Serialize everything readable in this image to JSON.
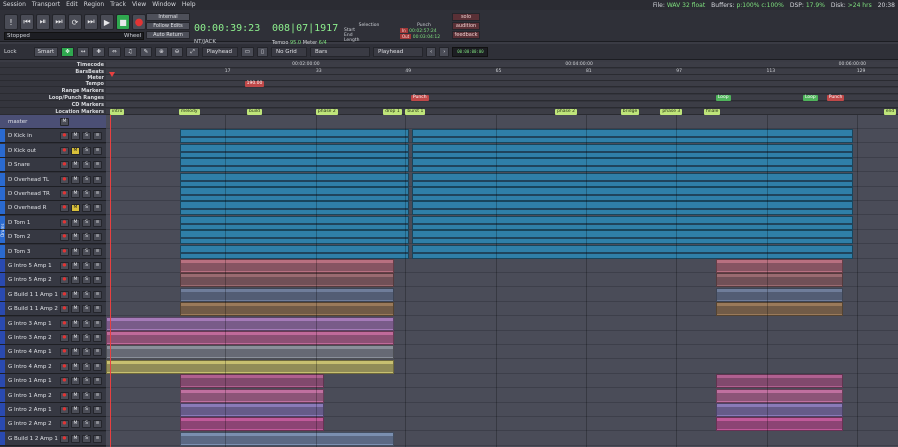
{
  "menu": [
    "Session",
    "Transport",
    "Edit",
    "Region",
    "Track",
    "View",
    "Window",
    "Help"
  ],
  "status": {
    "file_label": "File:",
    "file_val": "WAV 32 float",
    "buffers_label": "Buffers:",
    "buffers_val": "p:100% c:100%",
    "dsp_label": "DSP:",
    "dsp_val": "17.9%",
    "disk_label": "Disk:",
    "disk_val": ">24 hrs",
    "time": "20:38"
  },
  "transport": {
    "stopped_label": "Stopped",
    "wheel_label": "Wheel",
    "internal_label": "Internal",
    "follow_edits_label": "Follow Edits",
    "auto_return_label": "Auto Return",
    "clock_primary": "00:00:39:23",
    "clock_secondary": "008|07|1917",
    "jack_label": "NT/JACK",
    "tempo_label": "Tempo",
    "tempo_val": "95.0",
    "meter_label": "Meter",
    "meter_val": "6/4",
    "selection_label": "Selection",
    "start_label": "Start",
    "end_label": "End",
    "length_label": "Length",
    "punch_label": "Punch",
    "in_label": "In",
    "out_label": "Out",
    "punch_in_time": "00:02:57:24",
    "punch_out_time": "00:03:04:12",
    "solo_label": "solo",
    "audition_label": "audition",
    "feedback_label": "feedback"
  },
  "editbar": {
    "lock_label": "Lock",
    "smart_label": "Smart",
    "playhead_label": "Playhead",
    "grid_label": "No Grid",
    "bars_label": "Bars",
    "playhead2_label": "Playhead",
    "nudge_clock": "00:00:00:00"
  },
  "rulers": {
    "labels": [
      "Timecode",
      "BarsBeats",
      "Meter",
      "Tempo",
      "Range Markers",
      "Loop/Punch Ranges",
      "CD Markers",
      "Location Markers"
    ],
    "timecode_ticks": [
      {
        "text": "00:02:00:00",
        "pos": 0.235
      },
      {
        "text": "00:04:00:00",
        "pos": 0.58
      },
      {
        "text": "00:06:00:00",
        "pos": 0.925
      }
    ],
    "bars_ticks": [
      {
        "text": "17",
        "pos": 0.15
      },
      {
        "text": "33",
        "pos": 0.265
      },
      {
        "text": "49",
        "pos": 0.378
      },
      {
        "text": "65",
        "pos": 0.492
      },
      {
        "text": "81",
        "pos": 0.606
      },
      {
        "text": "97",
        "pos": 0.72
      },
      {
        "text": "113",
        "pos": 0.834
      },
      {
        "text": "129",
        "pos": 0.948
      }
    ],
    "tempo_marker": {
      "text": "190.00",
      "pos": 0.175
    },
    "punch_marker": {
      "text": "Punch",
      "pos": 0.385
    },
    "loop_markers": [
      {
        "text": "Loop",
        "pos": 0.77,
        "kind": "grn"
      },
      {
        "text": "Loop",
        "pos": 0.88,
        "kind": "grn"
      },
      {
        "text": "Punch",
        "pos": 0.91,
        "kind": "red"
      }
    ],
    "location_markers": [
      {
        "text": "intro",
        "pos": 0.005
      },
      {
        "text": "melody",
        "pos": 0.092
      },
      {
        "text": "build",
        "pos": 0.178
      },
      {
        "text": "phase 2",
        "pos": 0.265
      },
      {
        "text": "drop 1",
        "pos": 0.35
      },
      {
        "text": "burst 1",
        "pos": 0.378
      },
      {
        "text": "phase 2",
        "pos": 0.567
      },
      {
        "text": "bridge",
        "pos": 0.65
      },
      {
        "text": "phase 3",
        "pos": 0.7
      },
      {
        "text": "finale",
        "pos": 0.755
      },
      {
        "text": "end",
        "pos": 0.982
      }
    ]
  },
  "colors": {
    "drums_region": "#2f7fa8",
    "drums_group": "#2a6ad0",
    "guitar_group": "#2a4ab0"
  },
  "group_tab": "Drums",
  "tracks": [
    {
      "name": "master",
      "type": "master"
    },
    {
      "name": "D Kick in",
      "sel": false
    },
    {
      "name": "D Kick out",
      "sel": true
    },
    {
      "name": "D Snare",
      "sel": false
    },
    {
      "name": "D Overhead TL",
      "sel": false
    },
    {
      "name": "D Overhead TR",
      "sel": false
    },
    {
      "name": "D Overhead R",
      "sel": true
    },
    {
      "name": "D Tom 1",
      "sel": false
    },
    {
      "name": "D Tom 2",
      "sel": false
    },
    {
      "name": "D Tom 3",
      "sel": false
    },
    {
      "name": "G Intro 5 Amp 1",
      "sel": false
    },
    {
      "name": "G Intro 5 Amp 2",
      "sel": false
    },
    {
      "name": "G Build 1 1 Amp 1",
      "sel": false
    },
    {
      "name": "G Build 1 1 Amp 2",
      "sel": false
    },
    {
      "name": "G Intro 3 Amp 1",
      "sel": false
    },
    {
      "name": "G Intro 3 Amp 2",
      "sel": false
    },
    {
      "name": "G Intro 4 Amp 1",
      "sel": false
    },
    {
      "name": "G Intro 4 Amp 2",
      "sel": false
    },
    {
      "name": "G Intro 1 Amp 1",
      "sel": false
    },
    {
      "name": "G Intro 1 Amp 2",
      "sel": false
    },
    {
      "name": "G Intro 2 Amp 1",
      "sel": false
    },
    {
      "name": "G Intro 2 Amp 2",
      "sel": false
    },
    {
      "name": "G Build 1 2 Amp 1",
      "sel": false
    }
  ]
}
